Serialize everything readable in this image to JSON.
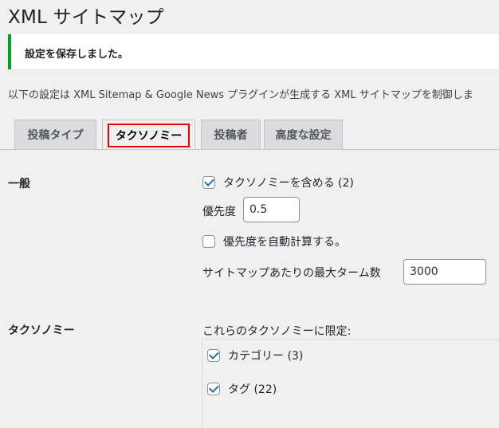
{
  "page_title": "XML サイトマップ",
  "notice": {
    "text": "設定を保存しました。",
    "accent_color": "#00a32a"
  },
  "intro_text": "以下の設定は XML Sitemap & Google News プラグインが生成する XML サイトマップを制御しま",
  "tabs": [
    {
      "label": "投稿タイプ",
      "active": false
    },
    {
      "label": "タクソノミー",
      "active": true,
      "highlighted": true
    },
    {
      "label": "投稿者",
      "active": false
    },
    {
      "label": "高度な設定",
      "active": false
    }
  ],
  "general": {
    "label": "一般",
    "include_taxonomies": {
      "label": "タクソノミーを含める (2)",
      "checked": true
    },
    "priority": {
      "label": "優先度",
      "value": "0.5"
    },
    "auto_priority": {
      "label": "優先度を自動計算する。",
      "checked": false
    },
    "max_terms": {
      "label": "サイトマップあたりの最大ターム数",
      "value": "3000"
    }
  },
  "taxonomies": {
    "label": "タクソノミー",
    "limit_label": "これらのタクソノミーに限定:",
    "items": [
      {
        "label": "カテゴリー (3)",
        "checked": true
      },
      {
        "label": "タグ (22)",
        "checked": true
      }
    ]
  }
}
